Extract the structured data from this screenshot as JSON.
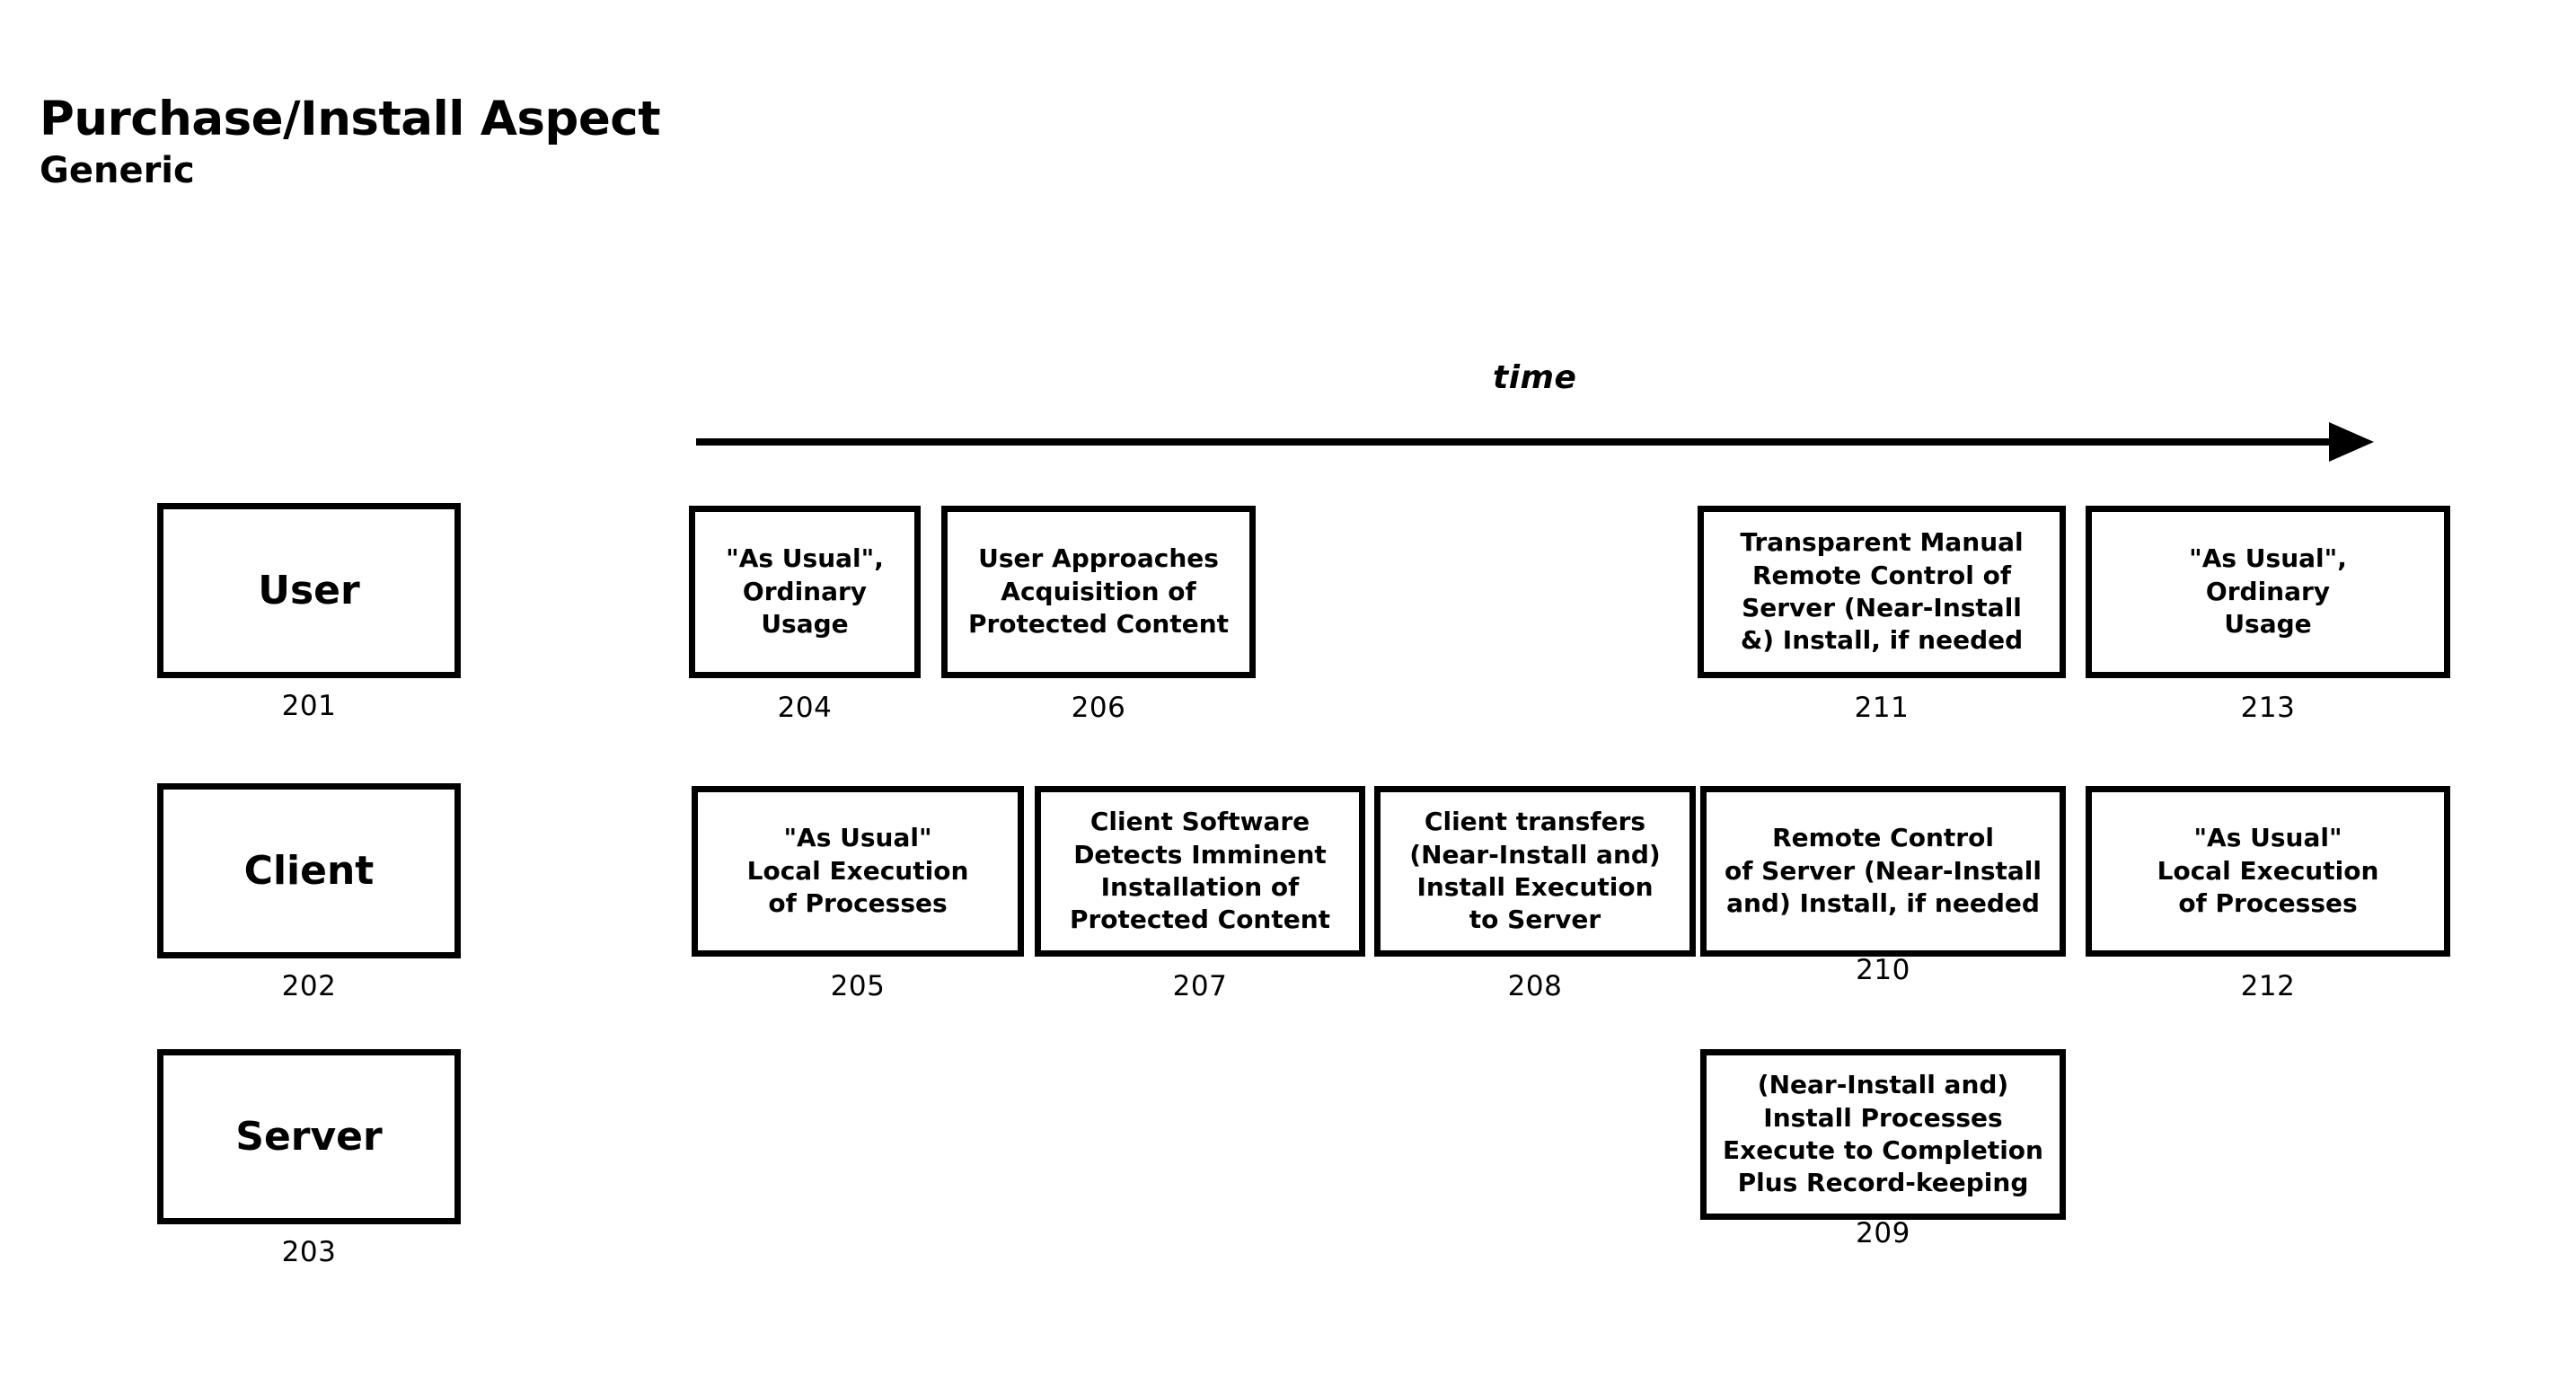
{
  "title": {
    "main": "Purchase/Install Aspect",
    "sub": "Generic"
  },
  "axis": {
    "label": "time",
    "direction": "left-to-right"
  },
  "lanes": [
    {
      "name": "User",
      "ref": "201"
    },
    {
      "name": "Client",
      "ref": "202"
    },
    {
      "name": "Server",
      "ref": "203"
    }
  ],
  "nodes": {
    "n204": {
      "text": "\"As Usual\",\nOrdinary\nUsage",
      "ref": "204",
      "lane": "User"
    },
    "n206": {
      "text": "User Approaches\nAcquisition of\nProtected Content",
      "ref": "206",
      "lane": "User"
    },
    "n211": {
      "text": "Transparent Manual\nRemote Control of\nServer (Near-Install\n&) Install, if needed",
      "ref": "211",
      "lane": "User"
    },
    "n213": {
      "text": "\"As Usual\",\nOrdinary\nUsage",
      "ref": "213",
      "lane": "User"
    },
    "n205": {
      "text": "\"As Usual\"\nLocal Execution\nof Processes",
      "ref": "205",
      "lane": "Client"
    },
    "n207": {
      "text": "Client Software\nDetects Imminent\nInstallation of\nProtected Content",
      "ref": "207",
      "lane": "Client"
    },
    "n208": {
      "text": "Client transfers\n(Near-Install and)\nInstall Execution\nto Server",
      "ref": "208",
      "lane": "Client"
    },
    "n210": {
      "text": "Remote Control\nof Server (Near-Install\nand) Install, if needed",
      "ref": "210",
      "lane": "Client"
    },
    "n212": {
      "text": "\"As Usual\"\nLocal Execution\nof Processes",
      "ref": "212",
      "lane": "Client"
    },
    "n209": {
      "text": "(Near-Install and)\nInstall Processes\nExecute to Completion\nPlus Record-keeping",
      "ref": "209",
      "lane": "Server"
    }
  },
  "colors": {
    "ink": "#000000",
    "paper": "#ffffff"
  }
}
